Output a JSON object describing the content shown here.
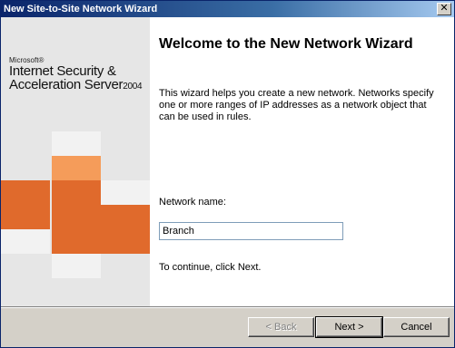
{
  "window": {
    "title": "New Site-to-Site Network Wizard",
    "close_glyph": "✕"
  },
  "banner": {
    "brand_small": "Microsoft®",
    "product_line1": "Internet Security &",
    "product_line2": "Acceleration Server",
    "product_year": "2004"
  },
  "content": {
    "heading": "Welcome to the New Network Wizard",
    "description": "This wizard helps you create a new network. Networks specify one or more ranges of IP addresses as a network object that can be used in rules.",
    "network_name_label": "Network name:",
    "network_name_value": "Branch",
    "continue_text": "To continue, click Next."
  },
  "buttons": {
    "back": "< Back",
    "next": "Next >",
    "cancel": "Cancel"
  },
  "colors": {
    "accent_orange": "#e06a2c",
    "light_orange": "#f59c5a",
    "titlebar": "#0a246a"
  }
}
